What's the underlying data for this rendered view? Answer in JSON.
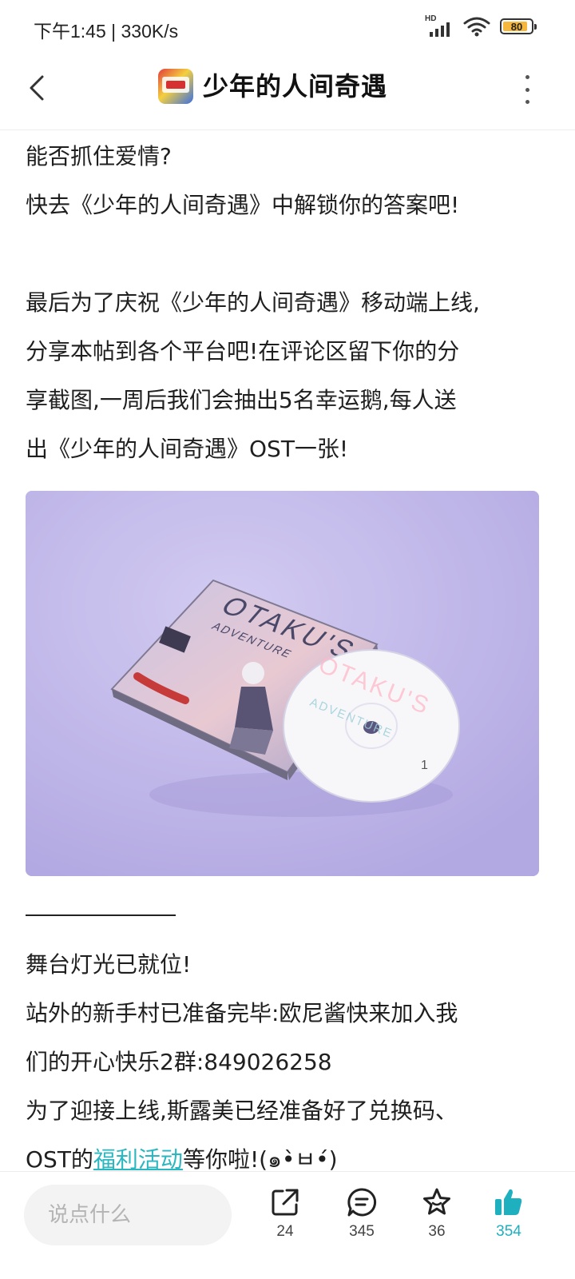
{
  "status_bar": {
    "time_speed": "下午1:45 | 330K/s",
    "network_label": "HD",
    "battery_level": "80"
  },
  "nav": {
    "title": "少年的人间奇遇"
  },
  "post": {
    "para1": [
      "能否抓住爱情?",
      "快去《少年的人间奇遇》中解锁你的答案吧!"
    ],
    "para2": [
      "最后为了庆祝《少年的人间奇遇》移动端上线,",
      "分享本帖到各个平台吧!在评论区留下你的分",
      "享截图,一周后我们会抽出5名幸运鹅,每人送",
      "出《少年的人间奇遇》OST一张!"
    ],
    "image": {
      "case_title": "OTAKU'S",
      "case_subtitle": "ADVENTURE",
      "disc_title": "OTAKU'S",
      "disc_subtitle": "ADVENTURE",
      "disc_number": "1",
      "background_color": "#c1b8ea"
    },
    "para3": [
      "舞台灯光已就位!",
      "站外的新手村已准备完毕:欧尼酱快来加入我",
      "们的开心快乐2群:849026258",
      "为了迎接上线,斯露美已经准备好了兑换码、"
    ],
    "last_line": {
      "prefix": "OST的",
      "link": "福利活动",
      "suffix": "等你啦!(๑•̀ㅂ•́)"
    }
  },
  "bottom_bar": {
    "comment_placeholder": "说点什么",
    "share_count": "24",
    "comment_count": "345",
    "favorite_count": "36",
    "like_count": "354",
    "accent_color": "#1fb0c0"
  }
}
